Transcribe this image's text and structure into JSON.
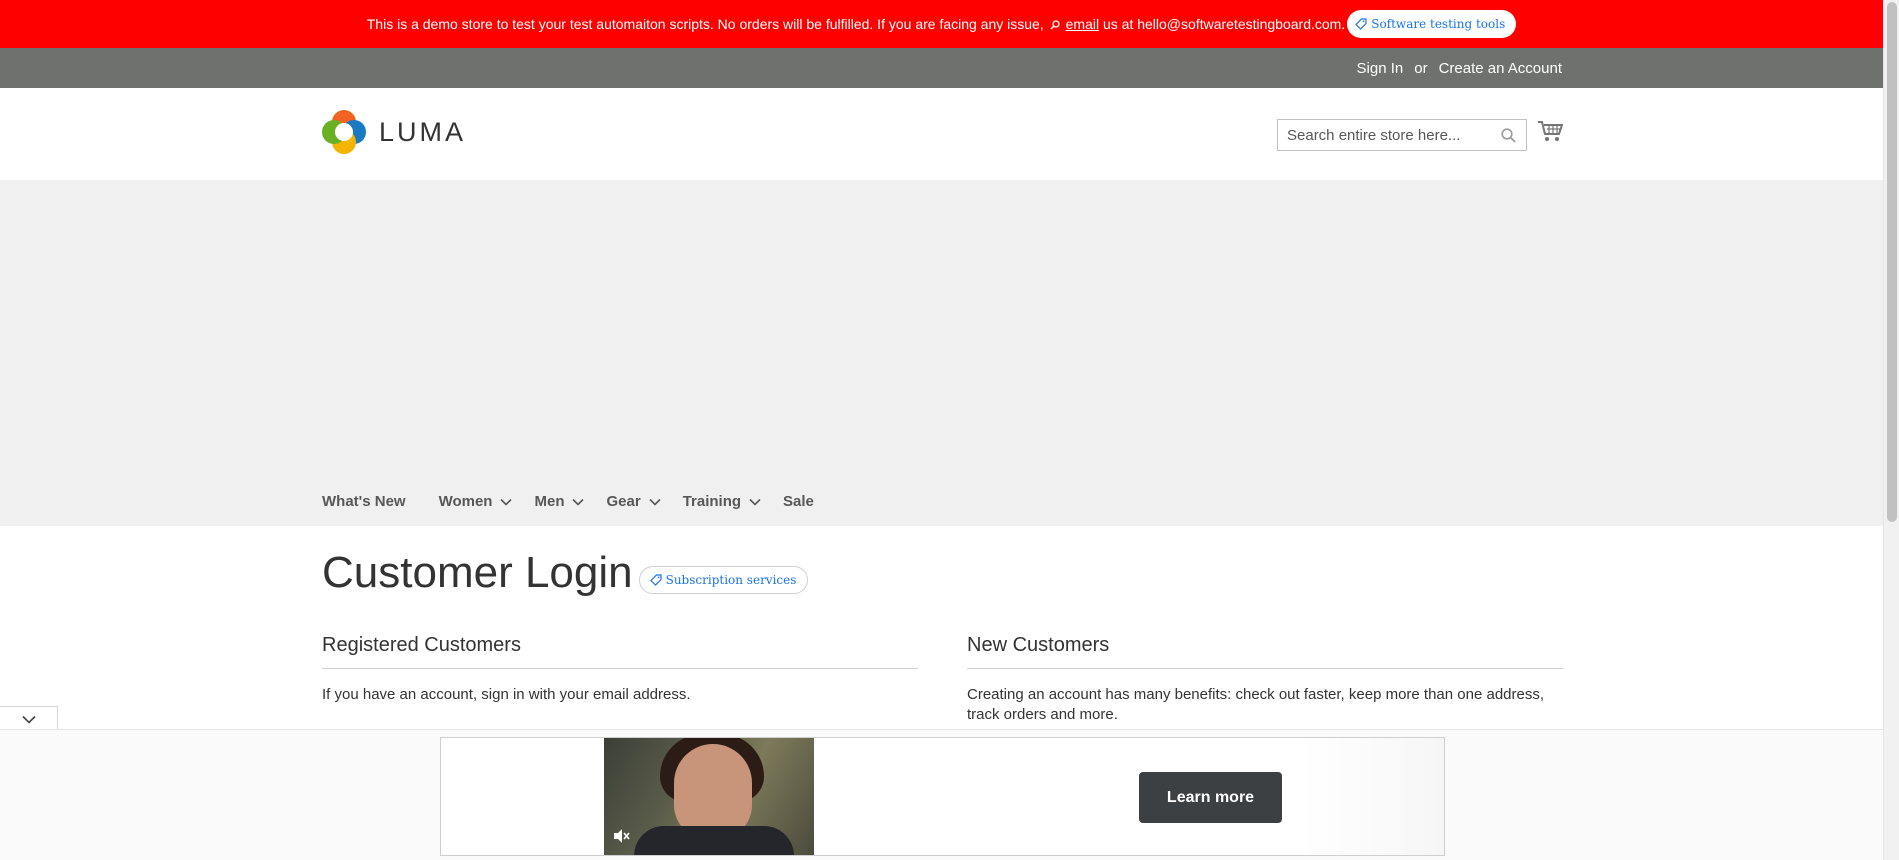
{
  "demo_notice": {
    "message": "This is a demo store to test your test automaiton scripts. No orders will be fulfilled. If you are facing any issue,",
    "email_link": "email",
    "message_end": " us at hello@softwaretestingboard.com.",
    "pill_label": "Software testing tools"
  },
  "panel": {
    "sign_in": "Sign In",
    "separator": "or",
    "create_account": "Create an Account"
  },
  "header": {
    "logo_text": "LUMA",
    "search_placeholder": "Search entire store here...",
    "search_value": ""
  },
  "nav": {
    "items": [
      {
        "label": "What's New",
        "has_submenu": false
      },
      {
        "label": "Women",
        "has_submenu": true
      },
      {
        "label": "Men",
        "has_submenu": true
      },
      {
        "label": "Gear",
        "has_submenu": true
      },
      {
        "label": "Training",
        "has_submenu": true
      },
      {
        "label": "Sale",
        "has_submenu": false
      }
    ]
  },
  "main": {
    "page_title": "Customer Login",
    "pill_label": "Subscription services",
    "registered": {
      "title": "Registered Customers",
      "text": "If you have an account, sign in with your email address."
    },
    "new_customers": {
      "title": "New Customers",
      "text": "Creating an account has many benefits: check out faster, keep more than one address, track orders and more."
    }
  },
  "ad": {
    "cta_label": "Learn more",
    "colors": {
      "button": "#3c4043"
    }
  },
  "colors": {
    "demo_bar": "#ff0000",
    "panel_bar": "#6e716e",
    "hero": "#f0f0f0",
    "pill_text": "#1a73e8"
  },
  "icons": [
    "tag-icon",
    "search-icon",
    "cart-icon",
    "chevron-down-icon",
    "mute-icon"
  ]
}
